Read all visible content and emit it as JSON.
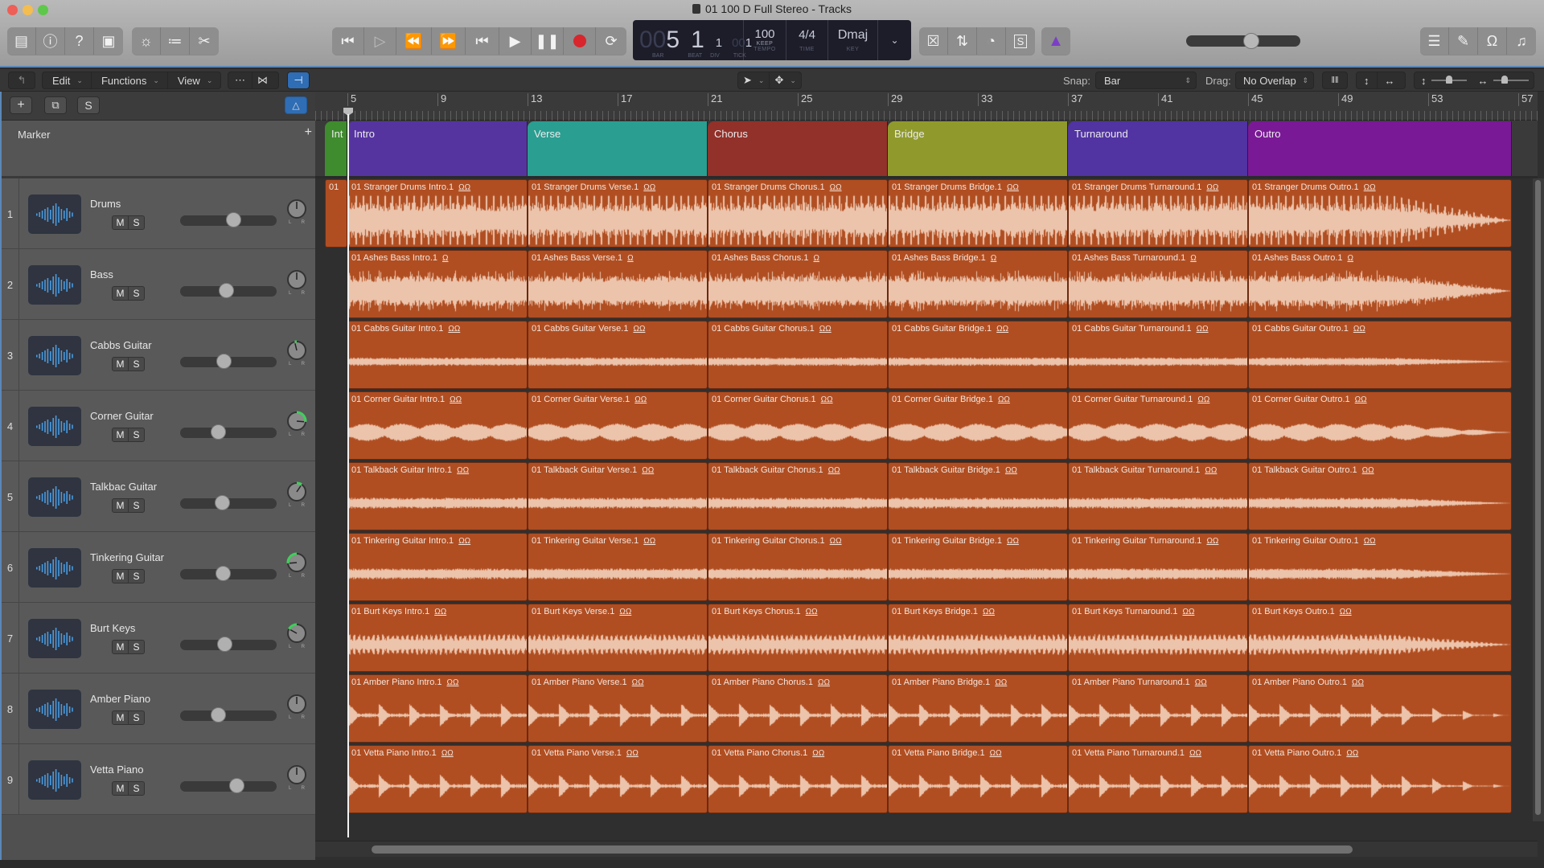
{
  "window": {
    "title": "01 100 D Full Stereo - Tracks"
  },
  "toolbar": {
    "left_icons": [
      "library-icon",
      "info-icon",
      "help-icon",
      "toolbar-icon"
    ],
    "edit_icons": [
      "smart-controls-icon",
      "mixer-icon",
      "editors-icon"
    ],
    "transport": [
      "go-to-beginning-icon",
      "play-from-selection-icon",
      "rewind-icon",
      "fast-forward-icon",
      "go-to-start-icon",
      "play-icon",
      "pause-icon",
      "record-icon",
      "cycle-icon"
    ],
    "lcd": {
      "bar_prefix": "00",
      "bar": "5",
      "beat": "1",
      "div": "1",
      "tick_prefix": "00",
      "tick": "1",
      "bar_label": "BAR",
      "beat_label": "BEAT",
      "div_label": "DIV",
      "tick_label": "TICK",
      "tempo": "100",
      "tempo_mode": "KEEP",
      "tempo_label": "TEMPO",
      "time_sig": "4/4",
      "time_label": "TIME",
      "key": "Dmaj",
      "key_label": "KEY"
    },
    "right_icons": [
      "replace-icon",
      "autopunch-icon",
      "tuner-icon",
      "solo-icon"
    ],
    "metronome_icon": "metronome-icon",
    "master_volume": 0.58,
    "view_icons": [
      "list-editors-icon",
      "note-pad-icon",
      "loop-browser-icon",
      "browsers-icon"
    ]
  },
  "local_toolbar": {
    "menus": [
      {
        "label": "Edit"
      },
      {
        "label": "Functions"
      },
      {
        "label": "View"
      }
    ],
    "snap_label": "Snap:",
    "snap_value": "Bar",
    "drag_label": "Drag:",
    "drag_value": "No Overlap"
  },
  "track_header": {
    "marker_label": "Marker",
    "tracks": [
      {
        "num": "1",
        "name": "Drums",
        "volume": 0.56,
        "pan": 0,
        "pan_color": ""
      },
      {
        "num": "2",
        "name": "Bass",
        "volume": 0.48,
        "pan": 0,
        "pan_color": ""
      },
      {
        "num": "3",
        "name": "Cabbs Guitar",
        "volume": 0.45,
        "pan": -0.1,
        "pan_color": "#3fcf5a"
      },
      {
        "num": "4",
        "name": "Corner Guitar",
        "volume": 0.38,
        "pan": 0.7,
        "pan_color": "#3fcf5a"
      },
      {
        "num": "5",
        "name": "Talkbac Guitar",
        "volume": 0.43,
        "pan": 0.25,
        "pan_color": "#3fcf5a"
      },
      {
        "num": "6",
        "name": "Tinkering Guitar",
        "volume": 0.44,
        "pan": -0.7,
        "pan_color": "#3fcf5a"
      },
      {
        "num": "7",
        "name": "Burt Keys",
        "volume": 0.46,
        "pan": -0.45,
        "pan_color": "#3fcf5a"
      },
      {
        "num": "8",
        "name": "Amber Piano",
        "volume": 0.38,
        "pan": 0,
        "pan_color": ""
      },
      {
        "num": "9",
        "name": "Vetta Piano",
        "volume": 0.6,
        "pan": 0,
        "pan_color": ""
      }
    ],
    "mute_label": "M",
    "solo_label": "S"
  },
  "ruler": {
    "bars": [
      "5",
      "9",
      "13",
      "17",
      "21",
      "25",
      "29",
      "33",
      "37",
      "41",
      "45",
      "49",
      "53",
      "57"
    ],
    "playhead_bar": 5
  },
  "markers": [
    {
      "name": "Int",
      "start": 4,
      "end": 5,
      "color": "#3f8c2e"
    },
    {
      "name": "Intro",
      "start": 5,
      "end": 13,
      "color": "#5634a0"
    },
    {
      "name": "Verse",
      "start": 13,
      "end": 21,
      "color": "#2a9e91"
    },
    {
      "name": "Chorus",
      "start": 21,
      "end": 29,
      "color": "#92302a"
    },
    {
      "name": "Bridge",
      "start": 29,
      "end": 37,
      "color": "#909a2c"
    },
    {
      "name": "Turnaround",
      "start": 37,
      "end": 45,
      "color": "#5133a2"
    },
    {
      "name": "Outro",
      "start": 45,
      "end": 56.7,
      "color": "#7a1996"
    }
  ],
  "sections": [
    "Intro",
    "Verse",
    "Chorus",
    "Bridge",
    "Turnaround",
    "Outro"
  ],
  "regions": [
    {
      "track": "Drums",
      "prefix": "01 Stranger Drums",
      "stereo": true,
      "first_stub": "01"
    },
    {
      "track": "Bass",
      "prefix": "01 Ashes Bass",
      "stereo": false
    },
    {
      "track": "Cabbs Guitar",
      "prefix": "01 Cabbs Guitar",
      "stereo": true
    },
    {
      "track": "Corner Guitar",
      "prefix": "01 Corner Guitar",
      "stereo": true
    },
    {
      "track": "Talkbac Guitar",
      "prefix": "01 Talkback Guitar",
      "stereo": true
    },
    {
      "track": "Tinkering Guitar",
      "prefix": "01 Tinkering Guitar",
      "stereo": true
    },
    {
      "track": "Burt Keys",
      "prefix": "01 Burt Keys",
      "stereo": true
    },
    {
      "track": "Amber Piano",
      "prefix": "01 Amber Piano",
      "stereo": true
    },
    {
      "track": "Vetta Piano",
      "prefix": "01 Vetta Piano",
      "stereo": true
    }
  ],
  "region_labels": [
    [
      "01 Stranger Drums Intro.1",
      "01 Stranger Drums Verse.1",
      "01 Stranger Drums Chorus.1",
      "01 Stranger Drums Bridge.1",
      "01 Stranger Drums Turnaround.1",
      "01 Stranger Drums Outro.1"
    ],
    [
      "01 Ashes Bass Intro.1",
      "01 Ashes Bass Verse.1",
      "01 Ashes Bass Chorus.1",
      "01 Ashes Bass Bridge.1",
      "01 Ashes Bass Turnaround.1",
      "01 Ashes Bass Outro.1"
    ],
    [
      "01 Cabbs Guitar Intro.1",
      "01 Cabbs Guitar Verse.1",
      "01 Cabbs Guitar Chorus.1",
      "01 Cabbs Guitar Bridge.1",
      "01 Cabbs Guitar Turnaround.1",
      "01 Cabbs Guitar Outro.1"
    ],
    [
      "01 Corner Guitar Intro.1",
      "01 Corner Guitar Verse.1",
      "01 Corner Guitar Chorus.1",
      "01 Corner Guitar Bridge.1",
      "01 Corner Guitar Turnaround.1",
      "01 Corner Guitar Outro.1"
    ],
    [
      "01 Talkback Guitar Intro.1",
      "01 Talkback Guitar Verse.1",
      "01 Talkback Guitar Chorus.1",
      "01 Talkback Guitar Bridge.1",
      "01 Talkback Guitar Turnaround.1",
      "01 Talkback Guitar Outro.1"
    ],
    [
      "01 Tinkering Guitar Intro.1",
      "01 Tinkering Guitar Verse.1",
      "01 Tinkering Guitar Chorus.1",
      "01 Tinkering Guitar Bridge.1",
      "01 Tinkering Guitar Turnaround.1",
      "01 Tinkering Guitar Outro.1"
    ],
    [
      "01 Burt Keys Intro.1",
      "01 Burt Keys Verse.1",
      "01 Burt Keys Chorus.1",
      "01 Burt Keys Bridge.1",
      "01 Burt Keys Turnaround.1",
      "01 Burt Keys Outro.1"
    ],
    [
      "01 Amber Piano Intro.1",
      "01 Amber Piano Verse.1",
      "01 Amber Piano Chorus.1",
      "01 Amber Piano Bridge.1",
      "01 Amber Piano Turnaround.1",
      "01 Amber Piano Outro.1"
    ],
    [
      "01 Vetta Piano Intro.1",
      "01 Vetta Piano Verse.1",
      "01 Vetta Piano Chorus.1",
      "01 Vetta Piano Bridge.1",
      "01 Vetta Piano Turnaround.1",
      "01 Vetta Piano Outro.1"
    ]
  ],
  "colors": {
    "region": "#b04e22",
    "waveform": "#ecc4ab",
    "record": "#d8262c",
    "selection_blue": "#2f6db5",
    "metronome": "#7b3fc6"
  }
}
